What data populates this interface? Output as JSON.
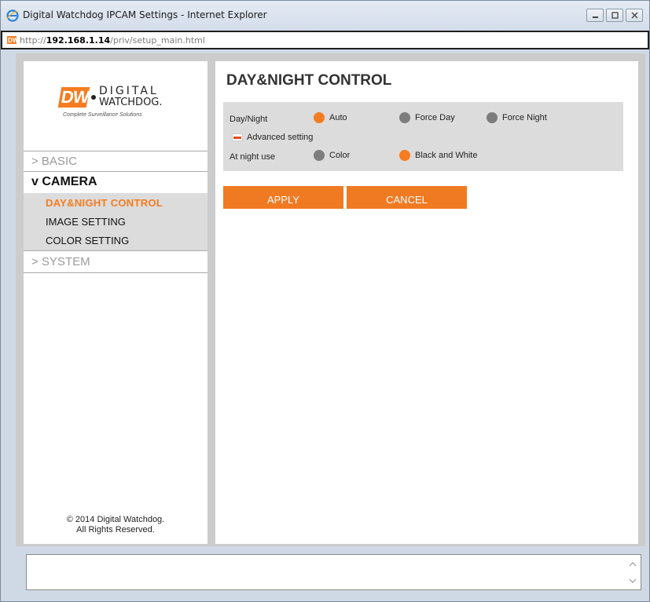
{
  "window": {
    "title": "Digital Watchdog IPCAM Settings - Internet Explorer",
    "url_prefix": "http://",
    "url_host": "192.168.1.14",
    "url_path": "/priv/setup_main.html"
  },
  "logo": {
    "mark": "DW",
    "line1": "DIGITAL",
    "line2": "WATCHDOG.",
    "tagline": "Complete Surveillance Solutions"
  },
  "sidebar": {
    "basic": "> BASIC",
    "camera": "v CAMERA",
    "camera_items": [
      {
        "label": "DAY&NIGHT CONTROL",
        "active": true
      },
      {
        "label": "IMAGE SETTING",
        "active": false
      },
      {
        "label": "COLOR SETTING",
        "active": false
      }
    ],
    "system": "> SYSTEM",
    "copyright_line1": "© 2014 Digital Watchdog.",
    "copyright_line2": "All Rights Reserved."
  },
  "main": {
    "title": "DAY&NIGHT CONTROL",
    "day_night_label": "Day/Night",
    "day_night_options": [
      "Auto",
      "Force Day",
      "Force Night"
    ],
    "day_night_selected": "Auto",
    "advanced_label": "Advanced setting",
    "night_use_label": "At night use",
    "night_use_options": [
      "Color",
      "Black and White"
    ],
    "night_use_selected": "Black and White",
    "apply_label": "APPLY",
    "cancel_label": "CANCEL"
  },
  "colors": {
    "accent": "#f57c20",
    "radio_unselected": "#7d7d7d",
    "panel_gray": "#dcdcdc"
  }
}
